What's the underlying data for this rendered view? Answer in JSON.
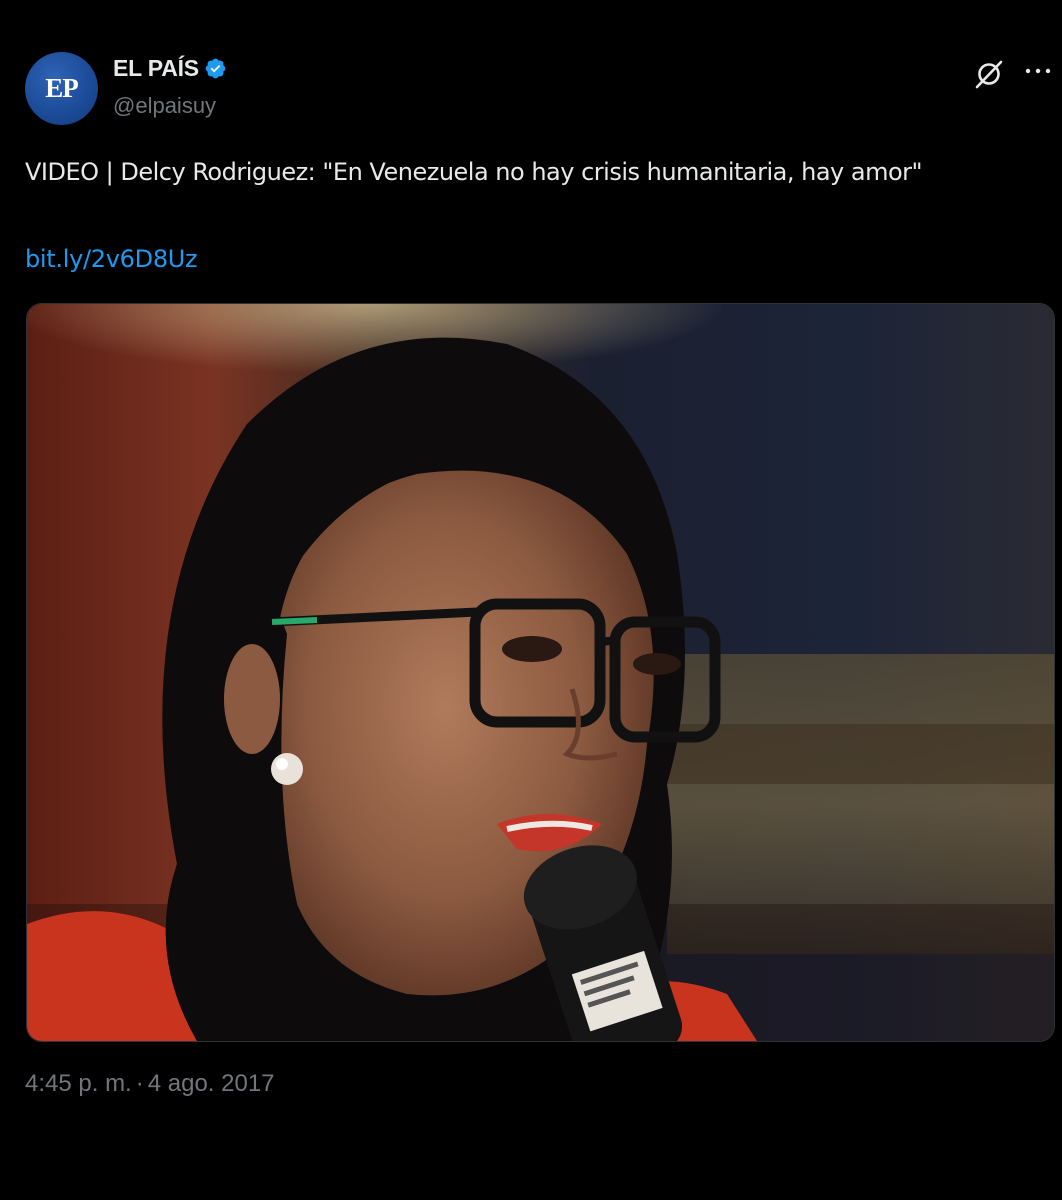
{
  "account": {
    "avatar_text": "EP",
    "display_name": "EL PAÍS",
    "handle": "@elpaisuy",
    "verified": true
  },
  "icons": {
    "verified": "verified-badge-icon",
    "grok": "grok-icon",
    "more": "more-options-icon"
  },
  "tweet": {
    "text": "VIDEO | Delcy Rodriguez: \"En Venezuela no hay crisis humanitaria, hay amor\"",
    "link": "bit.ly/2v6D8Uz",
    "media_alt": "Photo of a woman with glasses speaking into a microphone",
    "time": "4:45 p. m.",
    "separator": "·",
    "date": "4 ago. 2017"
  },
  "colors": {
    "background": "#000000",
    "text": "#e7e9ea",
    "secondary": "#71767b",
    "link": "#1d9bf0",
    "verified": "#1d9bf0"
  }
}
